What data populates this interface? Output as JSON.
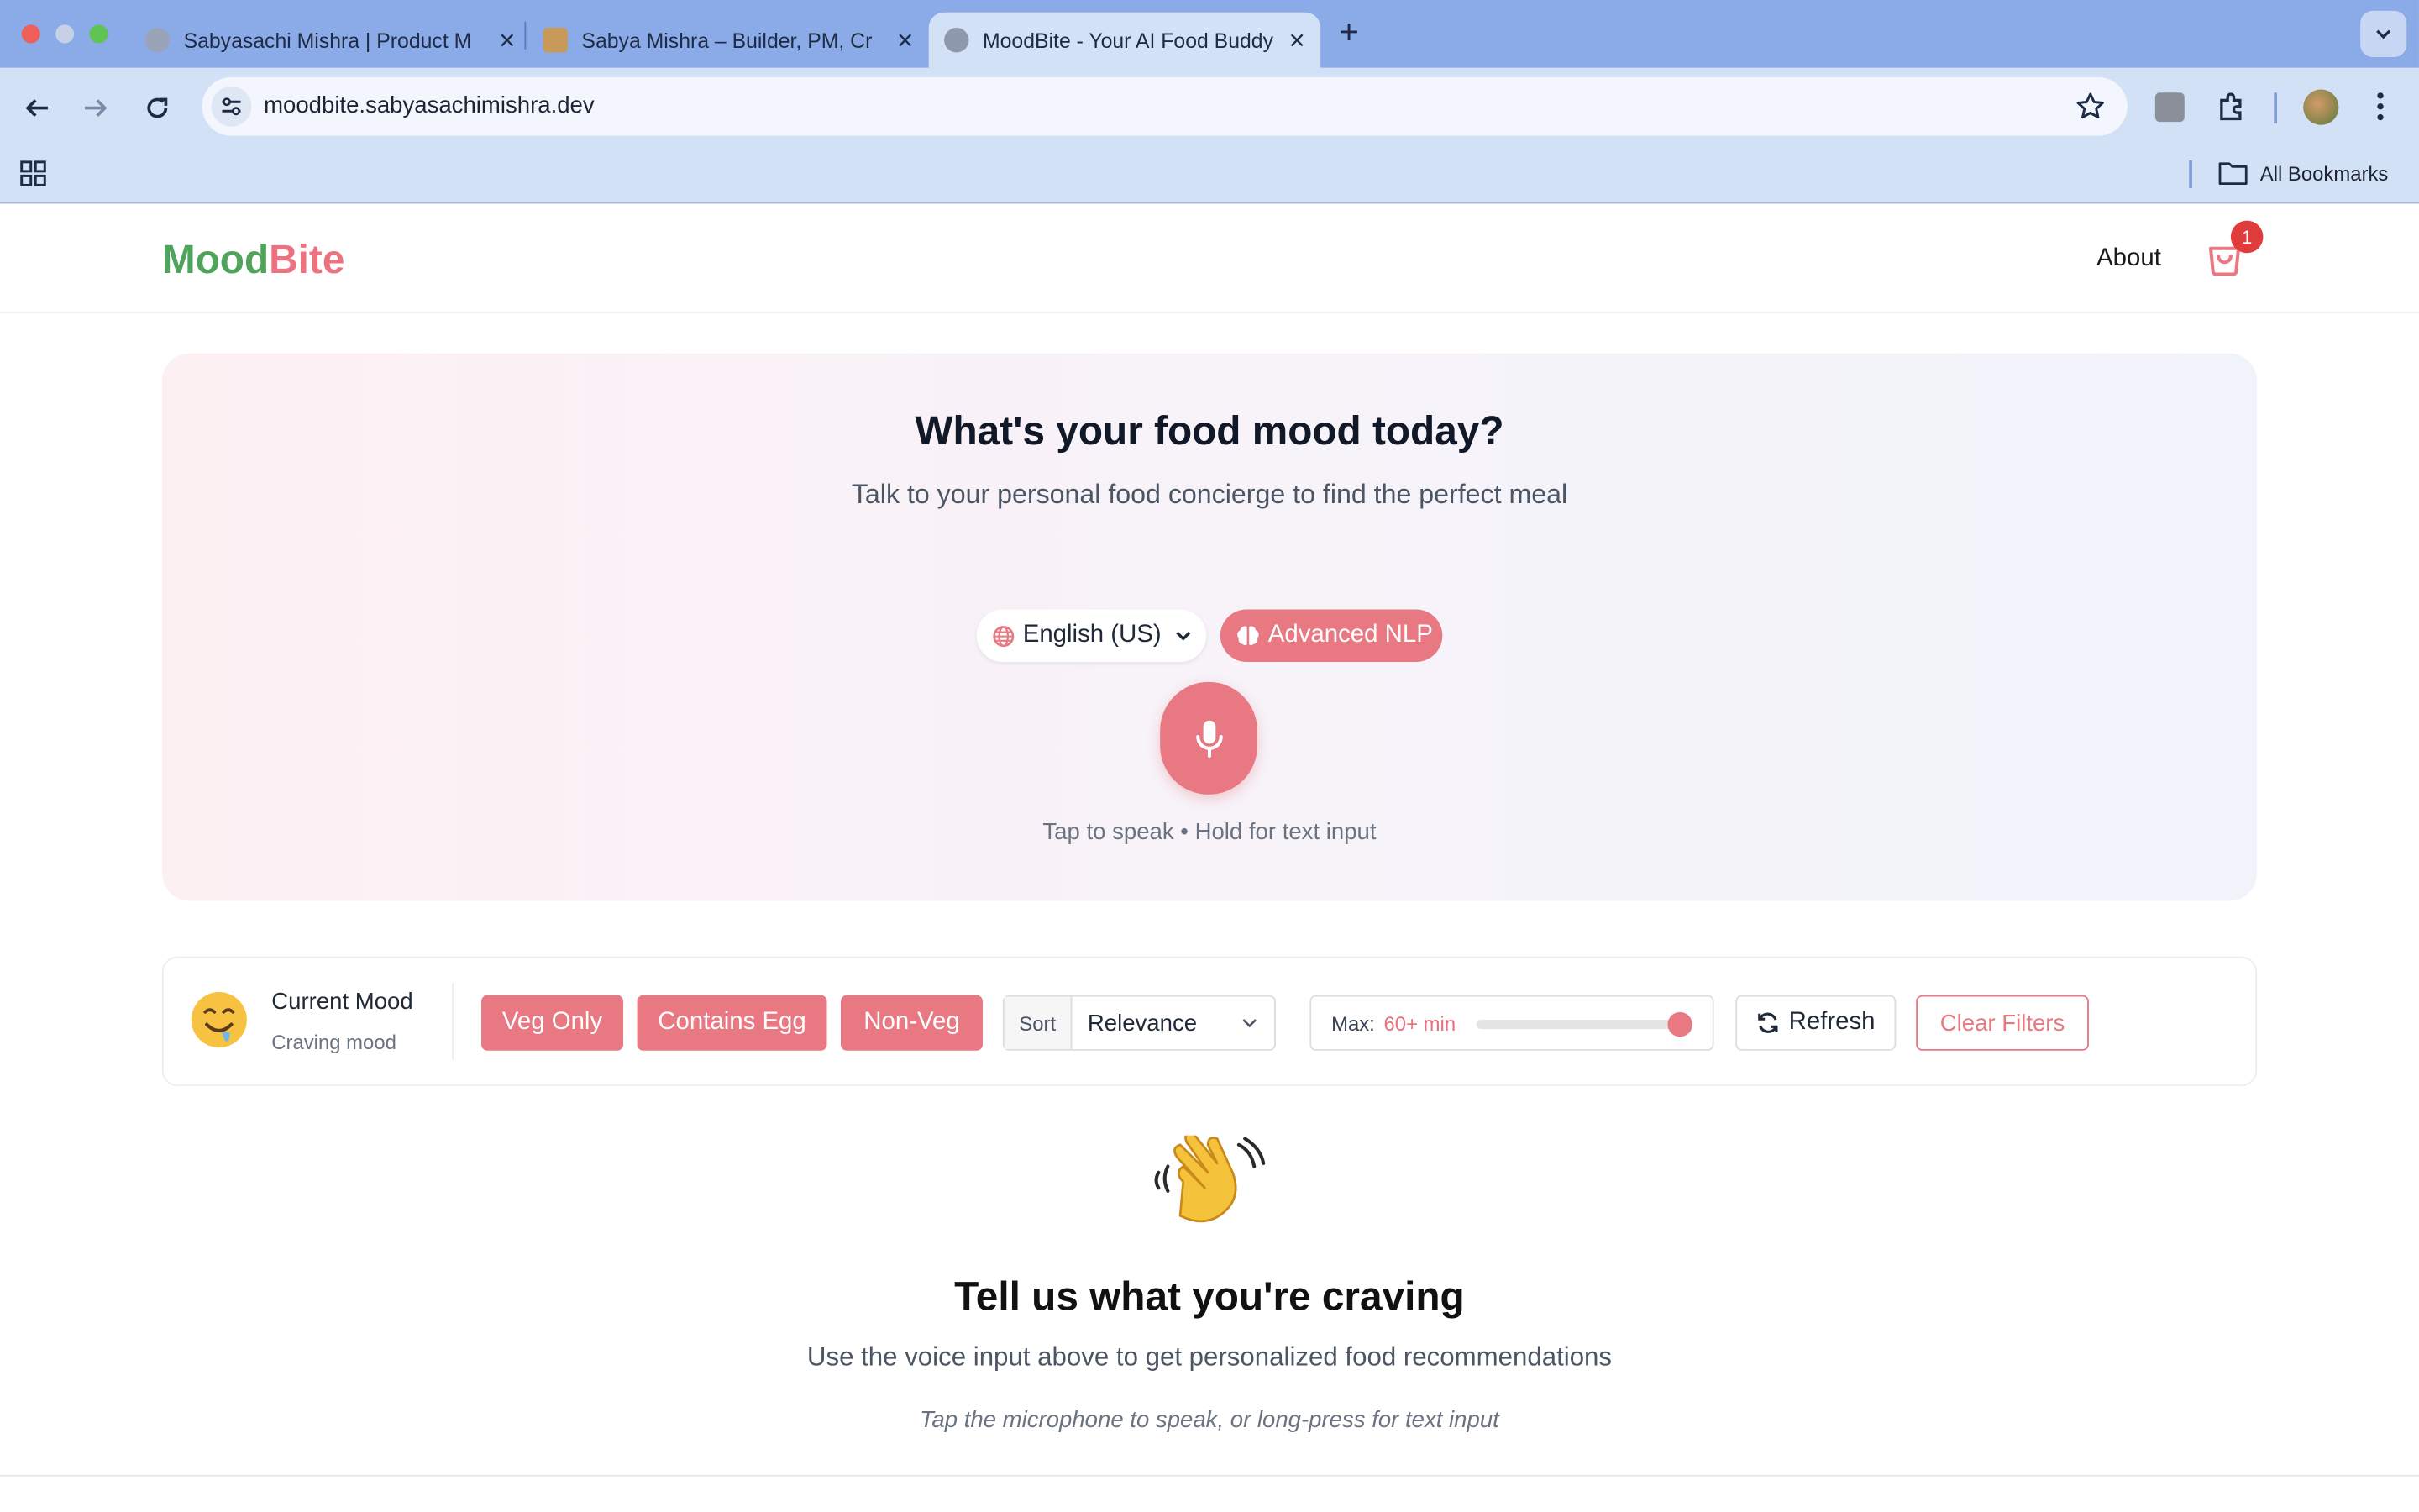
{
  "browser": {
    "tabs": [
      {
        "title": "Sabyasachi Mishra | Product M"
      },
      {
        "title": "Sabya Mishra – Builder, PM, Cr"
      },
      {
        "title": "MoodBite - Your AI Food Buddy"
      }
    ],
    "url": "moodbite.sabyasachimishra.dev",
    "bookmarks_label": "All Bookmarks"
  },
  "app": {
    "logo_part1": "Mood",
    "logo_part2": "Bite",
    "nav_about": "About",
    "cart_count": "1",
    "brand_colors": {
      "green": "#4fa35a",
      "pink": "#ec7280",
      "accent": "#e87882"
    }
  },
  "hero": {
    "title": "What's your food mood today?",
    "subtitle": "Talk to your personal food concierge to find the perfect meal",
    "language": "English (US)",
    "nlp_button": "Advanced NLP",
    "mic_hint": "Tap to speak • Hold for text input"
  },
  "filters": {
    "mood_title": "Current Mood",
    "mood_value": "Craving mood",
    "chips": [
      "Veg Only",
      "Contains Egg",
      "Non-Veg"
    ],
    "sort_label": "Sort",
    "sort_value": "Relevance",
    "max_label": "Max:",
    "max_value": "60+ min",
    "max_slider_fraction": 1.0,
    "refresh_label": "Refresh",
    "clear_label": "Clear Filters"
  },
  "empty_state": {
    "title": "Tell us what you're craving",
    "subtitle": "Use the voice input above to get personalized food recommendations",
    "hint": "Tap the microphone to speak, or long-press for text input"
  }
}
